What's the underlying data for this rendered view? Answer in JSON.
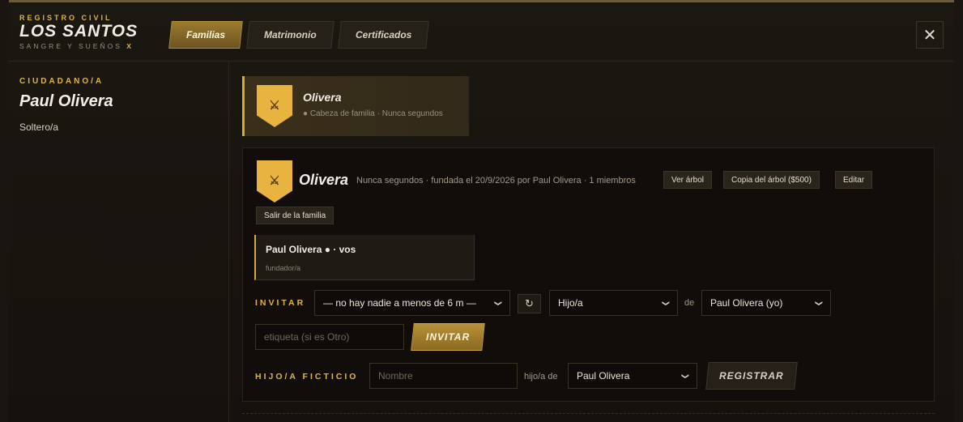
{
  "brand": {
    "top": "REGISTRO CIVIL",
    "main": "LOS SANTOS",
    "sub": "SANGRE Y SUEÑOS",
    "sub_mark": "X"
  },
  "tabs": [
    {
      "label": "Familias",
      "active": true
    },
    {
      "label": "Matrimonio",
      "active": false
    },
    {
      "label": "Certificados",
      "active": false
    }
  ],
  "close_label": "✕",
  "sidebar": {
    "label": "CIUDADANO/A",
    "name": "Paul Olivera",
    "status": "Soltero/a"
  },
  "family_card": {
    "name": "Olivera",
    "sub": "● Cabeza de familia · Nunca segundos",
    "emblem": "⚔"
  },
  "family_detail": {
    "name": "Olivera",
    "meta": "Nunca segundos · fundada el 20/9/2026 por Paul Olivera · 1 miembros",
    "emblem": "⚔",
    "buttons": {
      "tree": "Ver árbol",
      "copy_tree": "Copia del árbol ($500)",
      "edit": "Editar",
      "leave": "Salir de la familia"
    },
    "members": [
      {
        "name": "Paul Olivera ● · vos",
        "role": "fundador/a"
      }
    ]
  },
  "invite": {
    "label": "INVITAR",
    "nearby_select": "— no hay nadie a menos de 6 m —",
    "refresh_icon": "↻",
    "relation_select": "Hijo/a",
    "of_label": "de",
    "target_select": "Paul Olivera (yo)",
    "tag_placeholder": "etiqueta (si es Otro)",
    "submit": "INVITAR"
  },
  "fictional_child": {
    "label": "HIJO/A FICTICIO",
    "name_placeholder": "Nombre",
    "of_label": "hijo/a de",
    "parent_select": "Paul Olivera",
    "submit": "REGISTRAR"
  },
  "colors": {
    "accent": "#e0b445",
    "active_tab": "#9a7a2e",
    "background": "#15120d"
  }
}
